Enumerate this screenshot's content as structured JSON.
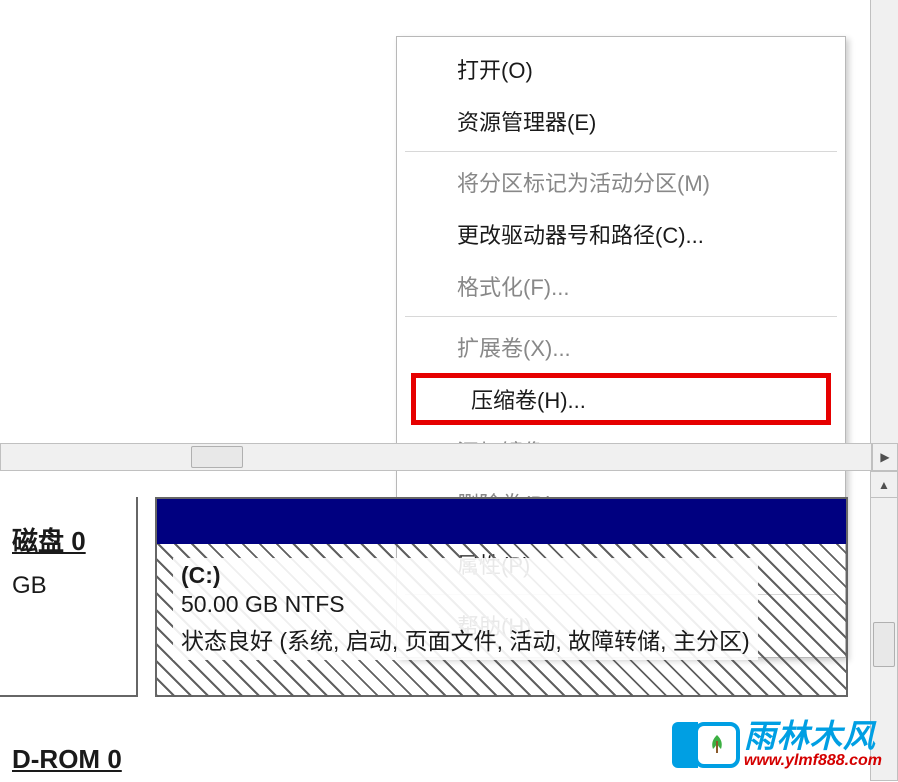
{
  "contextMenu": {
    "items": [
      {
        "label": "打开(O)",
        "enabled": true
      },
      {
        "label": "资源管理器(E)",
        "enabled": true
      },
      {
        "type": "separator"
      },
      {
        "label": "将分区标记为活动分区(M)",
        "enabled": false
      },
      {
        "label": "更改驱动器号和路径(C)...",
        "enabled": true
      },
      {
        "label": "格式化(F)...",
        "enabled": false
      },
      {
        "type": "separator"
      },
      {
        "label": "扩展卷(X)...",
        "enabled": false
      },
      {
        "label": "压缩卷(H)...",
        "enabled": true,
        "highlighted": true
      },
      {
        "label": "添加镜像(A)...",
        "enabled": false
      },
      {
        "label": "删除卷(D)...",
        "enabled": false
      },
      {
        "type": "separator"
      },
      {
        "label": "属性(P)",
        "enabled": true
      },
      {
        "type": "separator"
      },
      {
        "label": "帮助(H)",
        "enabled": true
      }
    ]
  },
  "diskPanel": {
    "diskLabel": "磁盘 0",
    "diskSizeUnit": "GB"
  },
  "volume": {
    "drive": "(C:)",
    "sizeInfo": "50.00 GB NTFS",
    "status": "状态良好 (系统, 启动, 页面文件, 活动, 故障转储, 主分区)"
  },
  "cdrom": {
    "label": "D-ROM 0"
  },
  "watermark": {
    "title": "雨林木风",
    "url": "www.ylmf888.com"
  }
}
